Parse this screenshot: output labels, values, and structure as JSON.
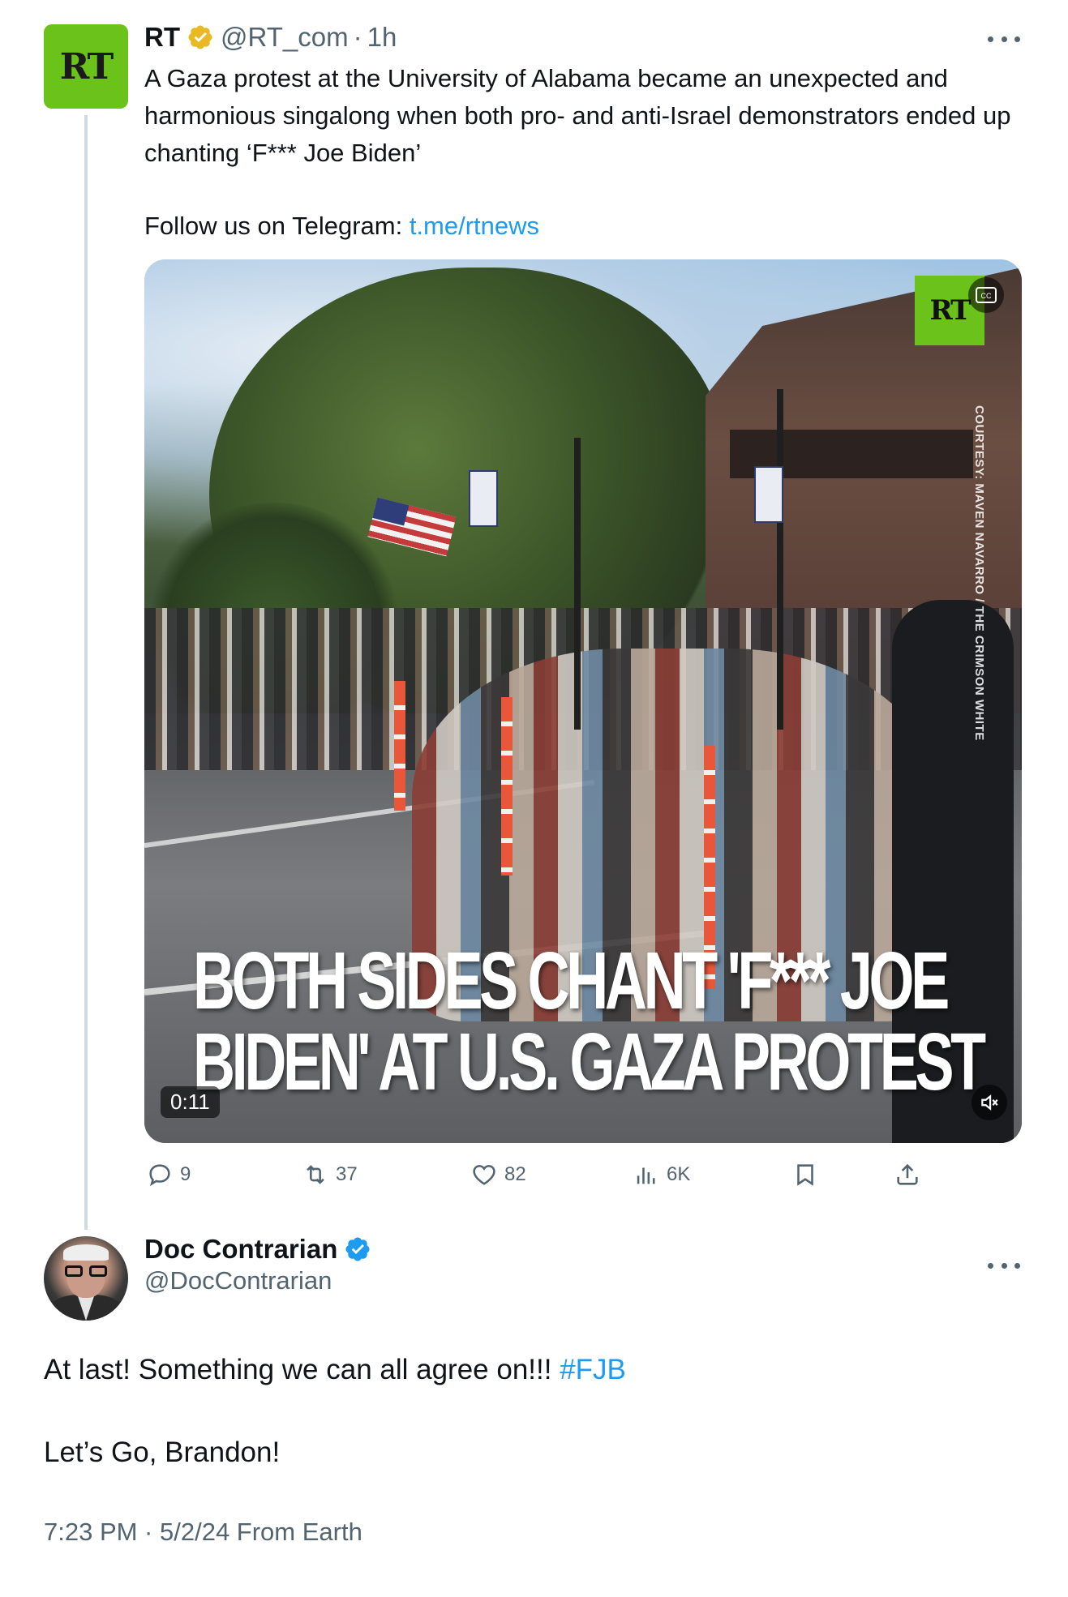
{
  "quoted_tweet": {
    "avatar_text": "RT",
    "display_name": "RT",
    "handle": "@RT_com",
    "separator": "·",
    "time": "1h",
    "text": "A Gaza protest at the University of Alabama became an unexpected and harmonious singalong when both pro- and anti-Israel demonstrators ended up chanting ‘F*** Joe Biden’",
    "follow_prefix": "Follow us on Telegram: ",
    "follow_link": "t.me/rtnews",
    "video": {
      "logo_text": "RT",
      "courtesy": "COURTESY: MAVEN NAVARRO / THE CRIMSON WHITE",
      "caption_line1": "BOTH SIDES CHANT 'F*** JOE",
      "caption_line2": "BIDEN' AT U.S. GAZA PROTEST",
      "duration": "0:11"
    },
    "stats": {
      "replies": "9",
      "reposts": "37",
      "likes": "82",
      "views": "6K"
    }
  },
  "reply_tweet": {
    "display_name": "Doc Contrarian",
    "handle": "@DocContrarian",
    "text_prefix": "At last! Something we can all agree on!!! ",
    "hashtag": "#FJB",
    "text2": "Let’s Go, Brandon!",
    "meta": "7:23 PM · 5/2/24 From Earth"
  },
  "colors": {
    "accent": "#1d9bf0",
    "secondary_text": "#536471",
    "verified_gold": "#e8b923",
    "verified_blue": "#1d9bf0",
    "rt_green": "#6ac21a"
  },
  "icons": {
    "more": "more-icon",
    "reply": "reply-icon",
    "repost": "repost-icon",
    "like": "heart-icon",
    "views": "views-icon",
    "bookmark": "bookmark-icon",
    "share": "share-icon",
    "mute": "mute-icon",
    "captions": "captions-icon"
  }
}
